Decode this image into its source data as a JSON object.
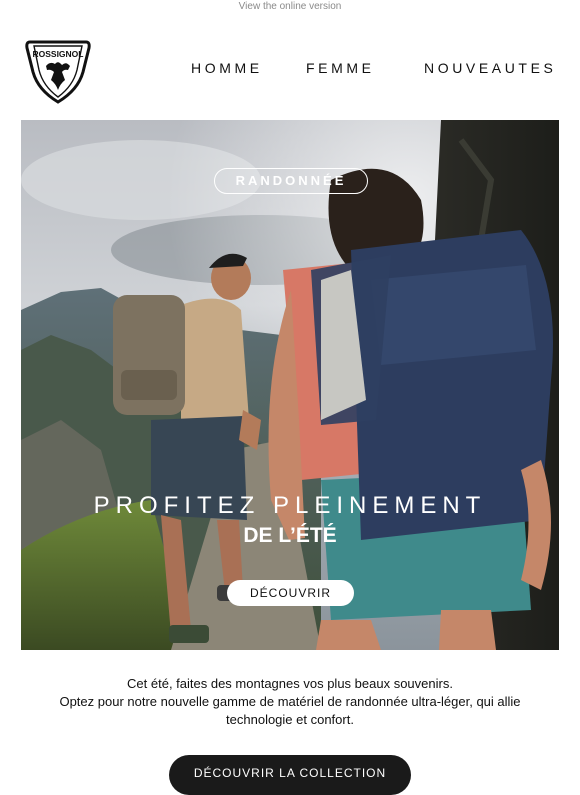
{
  "header": {
    "online_version": "View the online version",
    "brand": "ROSSIGNOL"
  },
  "nav": {
    "items": [
      "HOMME",
      "FEMME",
      "NOUVEAUTES"
    ]
  },
  "hero": {
    "tag": "RANDONNÉE",
    "headline_line1": "PROFITEZ PLEINEMENT",
    "headline_line2": "DE L’ÉTÉ",
    "button": "DÉCOUVRIR"
  },
  "body": {
    "line1": "Cet été, faites des montagnes vos plus beaux souvenirs.",
    "line2": "Optez pour notre nouvelle gamme de matériel de randonnée ultra-léger, qui allie technologie et confort."
  },
  "cta": {
    "label": "DÉCOUVRIR LA COLLECTION"
  }
}
